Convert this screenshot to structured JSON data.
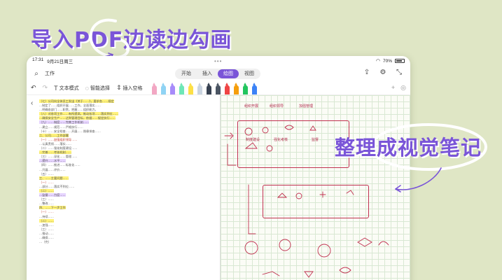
{
  "promo": {
    "title": "导入PDF边读边勾画",
    "note": "整理成视觉笔记"
  },
  "status_bar": {
    "time": "17:31",
    "date": "9月21日周三",
    "battery": "70%"
  },
  "top_bar": {
    "page_name": "工作",
    "tabs": [
      "开始",
      "插入",
      "绘图",
      "视图"
    ],
    "active_tab": "绘图"
  },
  "toolbar": {
    "text_mode": "文本模式",
    "smart_select": "智能选择",
    "insert_space": "插入空格",
    "pen_colors": [
      "#f2a7c3",
      "#8fd3f4",
      "#a78bfa",
      "#6ee7b7",
      "#fde047",
      "#cbd5e1",
      "#374151",
      "#4b5563",
      "#ef4444",
      "#f59e0b",
      "#22c55e",
      "#3b82f6"
    ]
  },
  "document": {
    "lines": [
      "（七）公司向全体员工发出《关于……》，要求各……规定",
      "…制定了……组织开展……工作，全面落实……",
      "…明确各部门……职责，把握……组织能力。",
      "（八）对各项工作……有所提高，推动各项……落实到位……",
      "…确保安全生产……达到管理目标，依据……规定执行……",
      "（九）……制度……完善工作机制……",
      "…建立……规范……严格执行……",
      "（十）……安全检查……开展……隐患排查……",
      "二、公司……工作部署",
      "（一）……加强组织领导……",
      "…认真贯彻……落实……",
      "（二）……强化制度建设……",
      "…完善……考核机制……",
      "（三）……深化……管理……",
      "…提升……水平……",
      "（四）……推进……标准化……",
      "…开展……评价……",
      "（五）……",
      "三、……主要问题……",
      "（一）……",
      "…部分……落实不到位……",
      "（二）……",
      "…监督……力度……",
      "（三）……",
      "…整改……",
      "四、……下一步工作",
      "（一）……",
      "…持续……",
      "（二）……",
      "…加强……",
      "（三）……",
      "…推动……",
      "…确保……",
      "…（完）"
    ]
  },
  "notes": {
    "sketch_labels": [
      "组织开展",
      "组织领导",
      "加强管理",
      "制度建设",
      "强化考核",
      "监督"
    ]
  }
}
